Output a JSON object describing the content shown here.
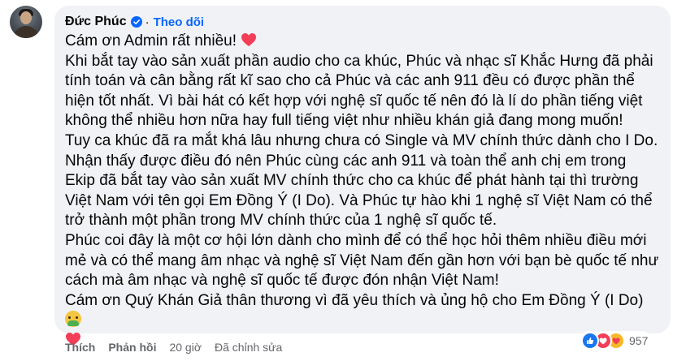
{
  "comment": {
    "author": "Đức Phúc",
    "follow_label": "Theo dõi",
    "separator": "·",
    "paragraphs": [
      "Cám ơn Admin rất nhiều!",
      "Khi bắt tay vào sản xuất phần audio cho ca khúc, Phúc và nhạc sĩ Khắc Hưng đã phải tính toán và cân bằng rất kĩ sao cho cả Phúc và các anh 911 đều có được phần thể hiện tốt nhất. Vì bài hát có kết hợp với nghệ sĩ quốc tế nên đó là lí do phần tiếng việt không thể nhiều hơn nữa hay full tiếng việt như nhiều khán giả đang mong muốn!",
      "Tuy ca khúc đã ra mắt khá lâu nhưng chưa có Single và MV chính thức dành cho I Do.",
      "Nhận thấy được điều đó nên Phúc cùng các anh 911 và toàn thể anh chị em trong Ekip đã bắt tay vào sản xuất MV chính thức cho ca khúc để phát hành tại thì trường Việt Nam với tên gọi Em Đồng Ý (I Do). Và Phúc tự hào khi 1 nghệ sĩ Việt Nam có thể trở thành một phần trong MV chính thức của 1 nghệ sĩ quốc tế.",
      "Phúc coi đây là một cơ hội lớn dành cho mình để có thể học hỏi thêm nhiều điều mới mẻ và có thể mang âm nhạc và nghệ sĩ Việt Nam đến gần hơn với bạn bè quốc tế như cách mà âm nhạc và nghệ sĩ quốc tế được đón nhận Việt Nam!",
      "Cám ơn Quý Khán Giả thân thương vì đã yêu thích và ủng hộ cho Em Đồng Ý (I Do)"
    ]
  },
  "actions": {
    "like": "Thích",
    "reply": "Phản hồi",
    "time": "20 giờ",
    "edited": "Đã chỉnh sửa"
  },
  "reactions": {
    "icons": [
      "like-reaction",
      "love-reaction",
      "care-reaction"
    ],
    "count": "957"
  },
  "colors": {
    "bubble": "#f0f2f5",
    "link": "#0866ff",
    "heart": "#f33e58"
  }
}
